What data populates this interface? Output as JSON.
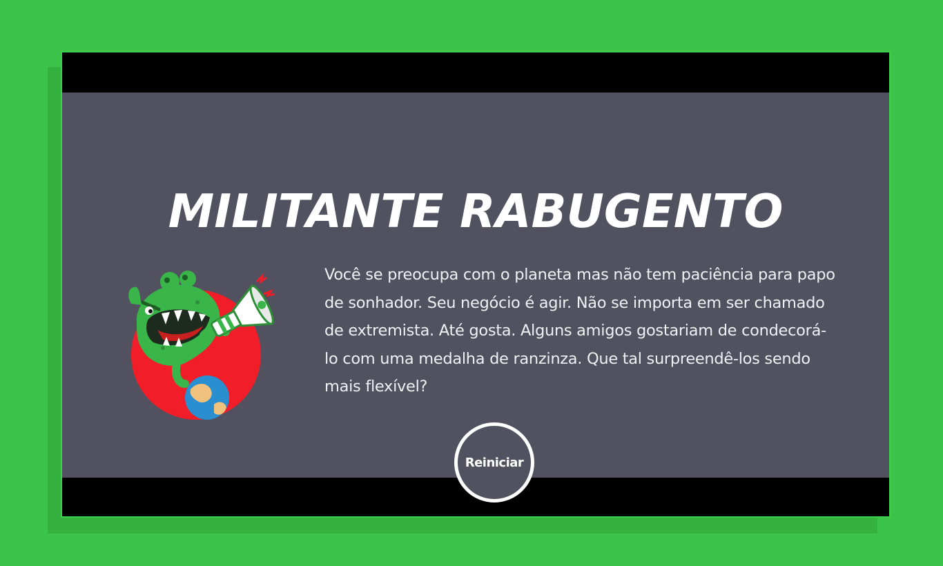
{
  "colors": {
    "background": "#3cc349",
    "card": "#525160",
    "bars": "#000000",
    "accent_red": "#f11d28",
    "monster_green": "#3ab54a"
  },
  "result": {
    "title": "MILITANTE RABUGENTO",
    "description": "Você se preocupa com o planeta mas não tem paciência para papo de sonhador. Seu negócio é agir. Não se importa em ser chamado de extremista. Até gosta. Alguns amigos gostariam de condecorá-lo com uma medalha de ranzinza. Que tal surpreendê-los sendo mais flexível?",
    "illustration_icon": "angry-monster-megaphone-icon"
  },
  "actions": {
    "restart_label": "Reiniciar"
  }
}
